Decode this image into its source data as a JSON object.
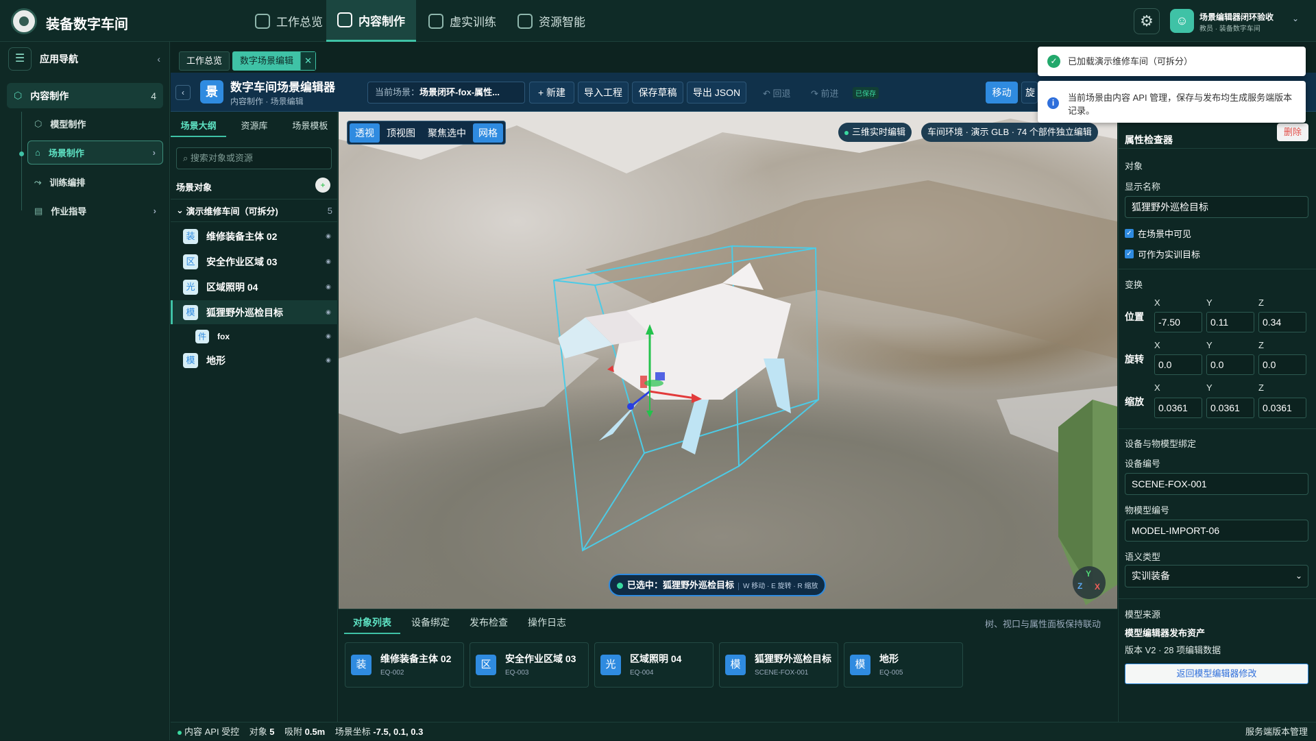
{
  "app": {
    "brand": "装备数字车间"
  },
  "topnav": [
    {
      "label": "工作总览",
      "icon": "grid-icon",
      "active": false
    },
    {
      "label": "内容制作",
      "icon": "cube-icon",
      "active": true
    },
    {
      "label": "虚实训练",
      "icon": "book-icon",
      "active": false
    },
    {
      "label": "资源智能",
      "icon": "brain-icon",
      "active": false
    }
  ],
  "user": {
    "name": "场景编辑器闭环验收",
    "role": "教员 · 装备数字车间"
  },
  "sidebar": {
    "title": "应用导航",
    "section": {
      "label": "内容制作",
      "count": "4"
    },
    "items": [
      {
        "label": "模型制作",
        "icon": "cube-icon"
      },
      {
        "label": "场景制作",
        "icon": "home-icon"
      },
      {
        "label": "训练编排",
        "icon": "flow-icon"
      },
      {
        "label": "作业指导",
        "icon": "doc-icon"
      }
    ]
  },
  "tabs": [
    {
      "label": "工作总览"
    },
    {
      "label": "数字场景编辑"
    }
  ],
  "toolbar": {
    "icon_text": "景",
    "title": "数字车间场景编辑器",
    "subtitle": "内容制作 · 场景编辑",
    "current_scene_label": "当前场景：",
    "current_scene_value": "场景闭环-fox-属性...",
    "new": "+ 新建",
    "import": "导入工程",
    "save": "保存草稿",
    "export": "导出 JSON",
    "undo": "↶ 回退",
    "redo": "↷ 前进",
    "saved": "已保存",
    "move": "移动",
    "rotate": "旋转"
  },
  "left_panel": {
    "tabs": [
      "场景大纲",
      "资源库",
      "场景模板"
    ],
    "search_placeholder": "搜索对象或资源",
    "header": "场景对象",
    "group": {
      "label": "演示维修车间（可拆分)",
      "count": "5"
    },
    "objects": [
      {
        "badge": "装",
        "label": "维修装备主体 02"
      },
      {
        "badge": "区",
        "label": "安全作业区域 03"
      },
      {
        "badge": "光",
        "label": "区域照明 04"
      },
      {
        "badge": "模",
        "label": "狐狸野外巡检目标"
      },
      {
        "badge": "件",
        "label": "fox"
      },
      {
        "badge": "模",
        "label": "地形"
      }
    ]
  },
  "viewport": {
    "tools": [
      "透视",
      "顶视图",
      "聚焦选中",
      "网格"
    ],
    "chip_live": "三维实时编辑",
    "chip_env": "车间环境 · 演示 GLB · 74 个部件独立编辑",
    "selected_label": "已选中：狐狸野外巡检目标",
    "selected_hint": "W 移动 · E 旋转 · R 缩放",
    "axis": {
      "y": "Y",
      "z": "Z",
      "x": "X"
    }
  },
  "bottom": {
    "tabs": [
      "对象列表",
      "设备绑定",
      "发布检查",
      "操作日志"
    ],
    "note": "树、视口与属性面板保持联动",
    "cards": [
      {
        "badge": "装",
        "name": "维修装备主体 02",
        "code": "EQ-002"
      },
      {
        "badge": "区",
        "name": "安全作业区域 03",
        "code": "EQ-003"
      },
      {
        "badge": "光",
        "name": "区域照明 04",
        "code": "EQ-004"
      },
      {
        "badge": "模",
        "name": "狐狸野外巡检目标",
        "code": "SCENE-FOX-001"
      },
      {
        "badge": "模",
        "name": "地形",
        "code": "EQ-005"
      }
    ]
  },
  "status": {
    "api": "内容 API 受控",
    "objects_label": "对象",
    "objects_value": "5",
    "snap_label": "吸附",
    "snap_value": "0.5m",
    "coord_label": "场景坐标",
    "coord_value": "-7.5, 0.1, 0.3",
    "right": "服务端版本管理"
  },
  "inspector": {
    "title": "属性检查器",
    "delete": "删除",
    "object_section": "对象",
    "display_name_label": "显示名称",
    "display_name": "狐狸野外巡检目标",
    "visible": "在场景中可见",
    "target": "可作为实训目标",
    "transform": "变换",
    "axis_x": "X",
    "axis_y": "Y",
    "axis_z": "Z",
    "position_label": "位置",
    "position": [
      "-7.50",
      "0.11",
      "0.34"
    ],
    "rotation_label": "旋转",
    "rotation": [
      "0.0",
      "0.0",
      "0.0"
    ],
    "scale_label": "缩放",
    "scale": [
      "0.0361",
      "0.0361",
      "0.0361"
    ],
    "binding_section": "设备与物模型绑定",
    "device_label": "设备编号",
    "device": "SCENE-FOX-001",
    "model_label": "物模型编号",
    "model": "MODEL-IMPORT-06",
    "semantic_label": "语义类型",
    "semantic": "实训装备",
    "source_section": "模型来源",
    "source_title": "模型编辑器发布资产",
    "source_version": "版本 V2 · 28 项编辑数据",
    "back_button": "返回模型编辑器修改"
  },
  "toasts": {
    "success": "已加载演示维修车间（可拆分）",
    "info": "当前场景由内容 API 管理，保存与发布均生成服务端版本记录。"
  }
}
